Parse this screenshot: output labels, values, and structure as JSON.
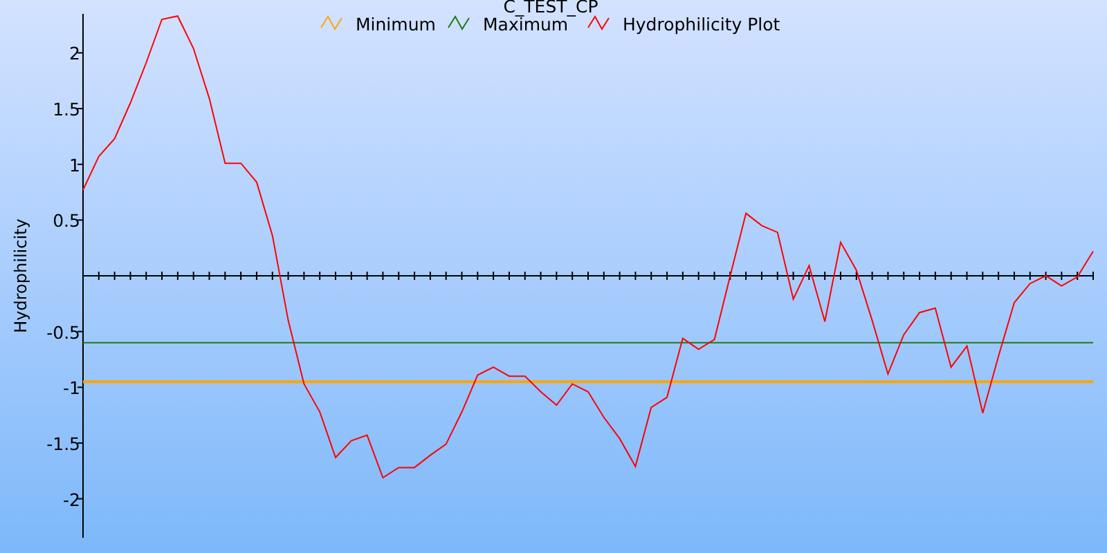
{
  "chart_data": {
    "type": "line",
    "title": "C_TEST_CP",
    "ylabel": "Hydrophilicity",
    "categories": [
      null,
      null,
      null,
      null,
      null,
      null,
      null,
      null,
      null,
      null,
      null,
      null,
      null,
      null,
      null,
      null,
      null,
      null,
      null,
      null,
      null,
      null,
      null,
      null,
      null,
      null,
      null,
      null,
      null,
      null,
      null,
      null,
      null,
      null,
      null,
      null,
      null,
      null,
      null,
      null,
      null,
      null,
      null,
      null,
      null,
      null,
      null,
      null,
      null,
      null,
      null,
      null,
      null,
      null,
      null,
      null,
      null,
      null,
      null,
      null,
      null,
      null,
      null,
      null,
      null
    ],
    "ylim": [
      -2.35,
      2.35
    ],
    "legend": "top",
    "yticks": [
      2,
      1.5,
      1,
      0.5,
      -0.5,
      -1,
      -1.5,
      -2
    ],
    "series": [
      {
        "name": "Minimum",
        "color": "#ffa500",
        "values": [
          -0.95,
          -0.95,
          -0.95,
          -0.95,
          -0.95,
          -0.95,
          -0.95,
          -0.95,
          -0.95,
          -0.95,
          -0.95,
          -0.95,
          -0.95,
          -0.95,
          -0.95,
          -0.95,
          -0.95,
          -0.95,
          -0.95,
          -0.95,
          -0.95,
          -0.95,
          -0.95,
          -0.95,
          -0.95,
          -0.95,
          -0.95,
          -0.95,
          -0.95,
          -0.95,
          -0.95,
          -0.95,
          -0.95,
          -0.95,
          -0.95,
          -0.95,
          -0.95,
          -0.95,
          -0.95,
          -0.95,
          -0.95,
          -0.95,
          -0.95,
          -0.95,
          -0.95,
          -0.95,
          -0.95,
          -0.95,
          -0.95,
          -0.95,
          -0.95,
          -0.95,
          -0.95,
          -0.95,
          -0.95,
          -0.95,
          -0.95,
          -0.95,
          -0.95,
          -0.95,
          -0.95,
          -0.95,
          -0.95,
          -0.95,
          -0.95
        ]
      },
      {
        "name": "Maximum",
        "color": "#1a7a1a",
        "values": [
          -0.6,
          -0.6,
          -0.6,
          -0.6,
          -0.6,
          -0.6,
          -0.6,
          -0.6,
          -0.6,
          -0.6,
          -0.6,
          -0.6,
          -0.6,
          -0.6,
          -0.6,
          -0.6,
          -0.6,
          -0.6,
          -0.6,
          -0.6,
          -0.6,
          -0.6,
          -0.6,
          -0.6,
          -0.6,
          -0.6,
          -0.6,
          -0.6,
          -0.6,
          -0.6,
          -0.6,
          -0.6,
          -0.6,
          -0.6,
          -0.6,
          -0.6,
          -0.6,
          -0.6,
          -0.6,
          -0.6,
          -0.6,
          -0.6,
          -0.6,
          -0.6,
          -0.6,
          -0.6,
          -0.6,
          -0.6,
          -0.6,
          -0.6,
          -0.6,
          -0.6,
          -0.6,
          -0.6,
          -0.6,
          -0.6,
          -0.6,
          -0.6,
          -0.6,
          -0.6,
          -0.6,
          -0.6,
          -0.6,
          -0.6,
          -0.6
        ]
      },
      {
        "name": "Hydrophilicity Plot",
        "color": "#ff0000",
        "values": [
          0.77,
          1.07,
          1.23,
          1.55,
          1.91,
          2.3,
          2.33,
          2.04,
          1.59,
          1.01,
          1.01,
          0.84,
          0.36,
          -0.4,
          -0.97,
          -1.22,
          -1.63,
          -1.48,
          -1.43,
          -1.81,
          -1.72,
          -1.72,
          -1.61,
          -1.51,
          -1.22,
          -0.89,
          -0.82,
          -0.9,
          -0.9,
          -1.04,
          -1.16,
          -0.97,
          -1.04,
          -1.27,
          -1.46,
          -1.71,
          -1.18,
          -1.09,
          -0.56,
          -0.66,
          -0.57,
          0.0,
          0.56,
          0.45,
          0.39,
          -0.21,
          0.09,
          -0.41,
          0.3,
          0.05,
          -0.4,
          -0.88,
          -0.53,
          -0.33,
          -0.29,
          -0.82,
          -0.63,
          -1.23,
          -0.72,
          -0.24,
          -0.07,
          0.0,
          -0.09,
          -0.01,
          0.22
        ]
      }
    ]
  }
}
